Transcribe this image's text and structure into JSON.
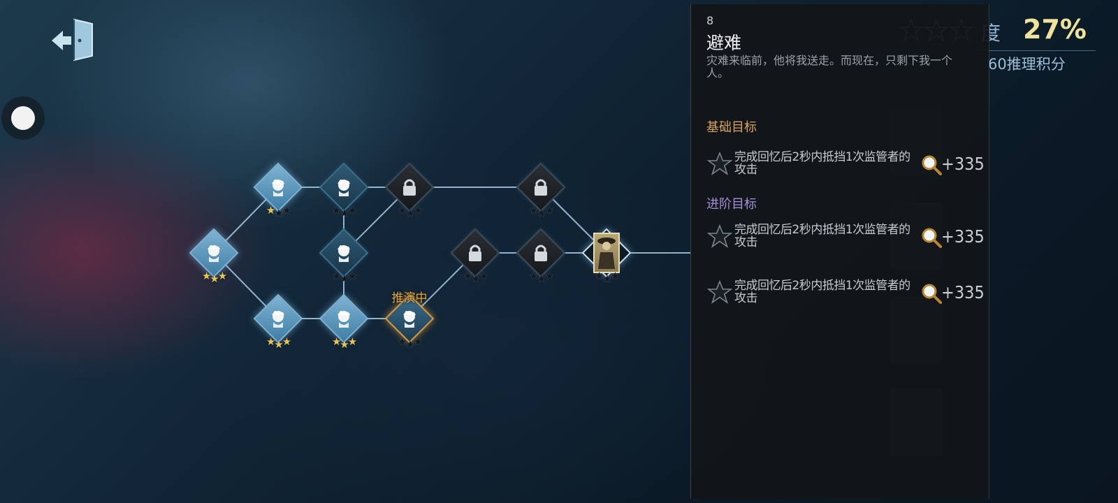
{
  "header": {
    "progress_label_visible": "度",
    "progress_value": "27%",
    "points_text": "60推理积分",
    "stars_total": 3,
    "stars_filled": 0
  },
  "map": {
    "current_label": "推演中",
    "nodes": [
      {
        "id": "n1",
        "state": "done",
        "stars": 3
      },
      {
        "id": "n2",
        "state": "done",
        "stars": 1
      },
      {
        "id": "n3",
        "state": "dim",
        "stars": 0
      },
      {
        "id": "n4",
        "state": "locked",
        "stars": 0
      },
      {
        "id": "n5",
        "state": "locked",
        "stars": 0
      },
      {
        "id": "n6",
        "state": "dim",
        "stars": 0
      },
      {
        "id": "n7",
        "state": "done",
        "stars": 3
      },
      {
        "id": "n8",
        "state": "done",
        "stars": 3
      },
      {
        "id": "n9",
        "state": "current",
        "stars": 0
      },
      {
        "id": "n10",
        "state": "locked",
        "stars": 0
      },
      {
        "id": "n11",
        "state": "locked",
        "stars": 0
      },
      {
        "id": "n12",
        "state": "character",
        "stars": 0
      }
    ]
  },
  "panel": {
    "number": "8",
    "title": "避难",
    "description": "灾难来临前，他将我送走。而现在，只剩下我一个人。",
    "basic_heading": "基础目标",
    "advanced_heading": "进阶目标",
    "goals": [
      {
        "text": "完成回忆后2秒内抵挡1次监管者的攻击",
        "reward": "+335"
      },
      {
        "text": "完成回忆后2秒内抵挡1次监管者的攻击",
        "reward": "+335"
      },
      {
        "text": "完成回忆后2秒内抵挡1次监管者的攻击",
        "reward": "+335"
      }
    ]
  },
  "icons": [
    "exit-door-icon",
    "detective-icon",
    "lock-icon",
    "star-icon",
    "magnifier-icon"
  ],
  "colors": {
    "accent_gold": "#e6c458",
    "current_orange": "#e8a93c",
    "basic_heading": "#d9a35a",
    "advanced_heading": "#a78fd9"
  }
}
